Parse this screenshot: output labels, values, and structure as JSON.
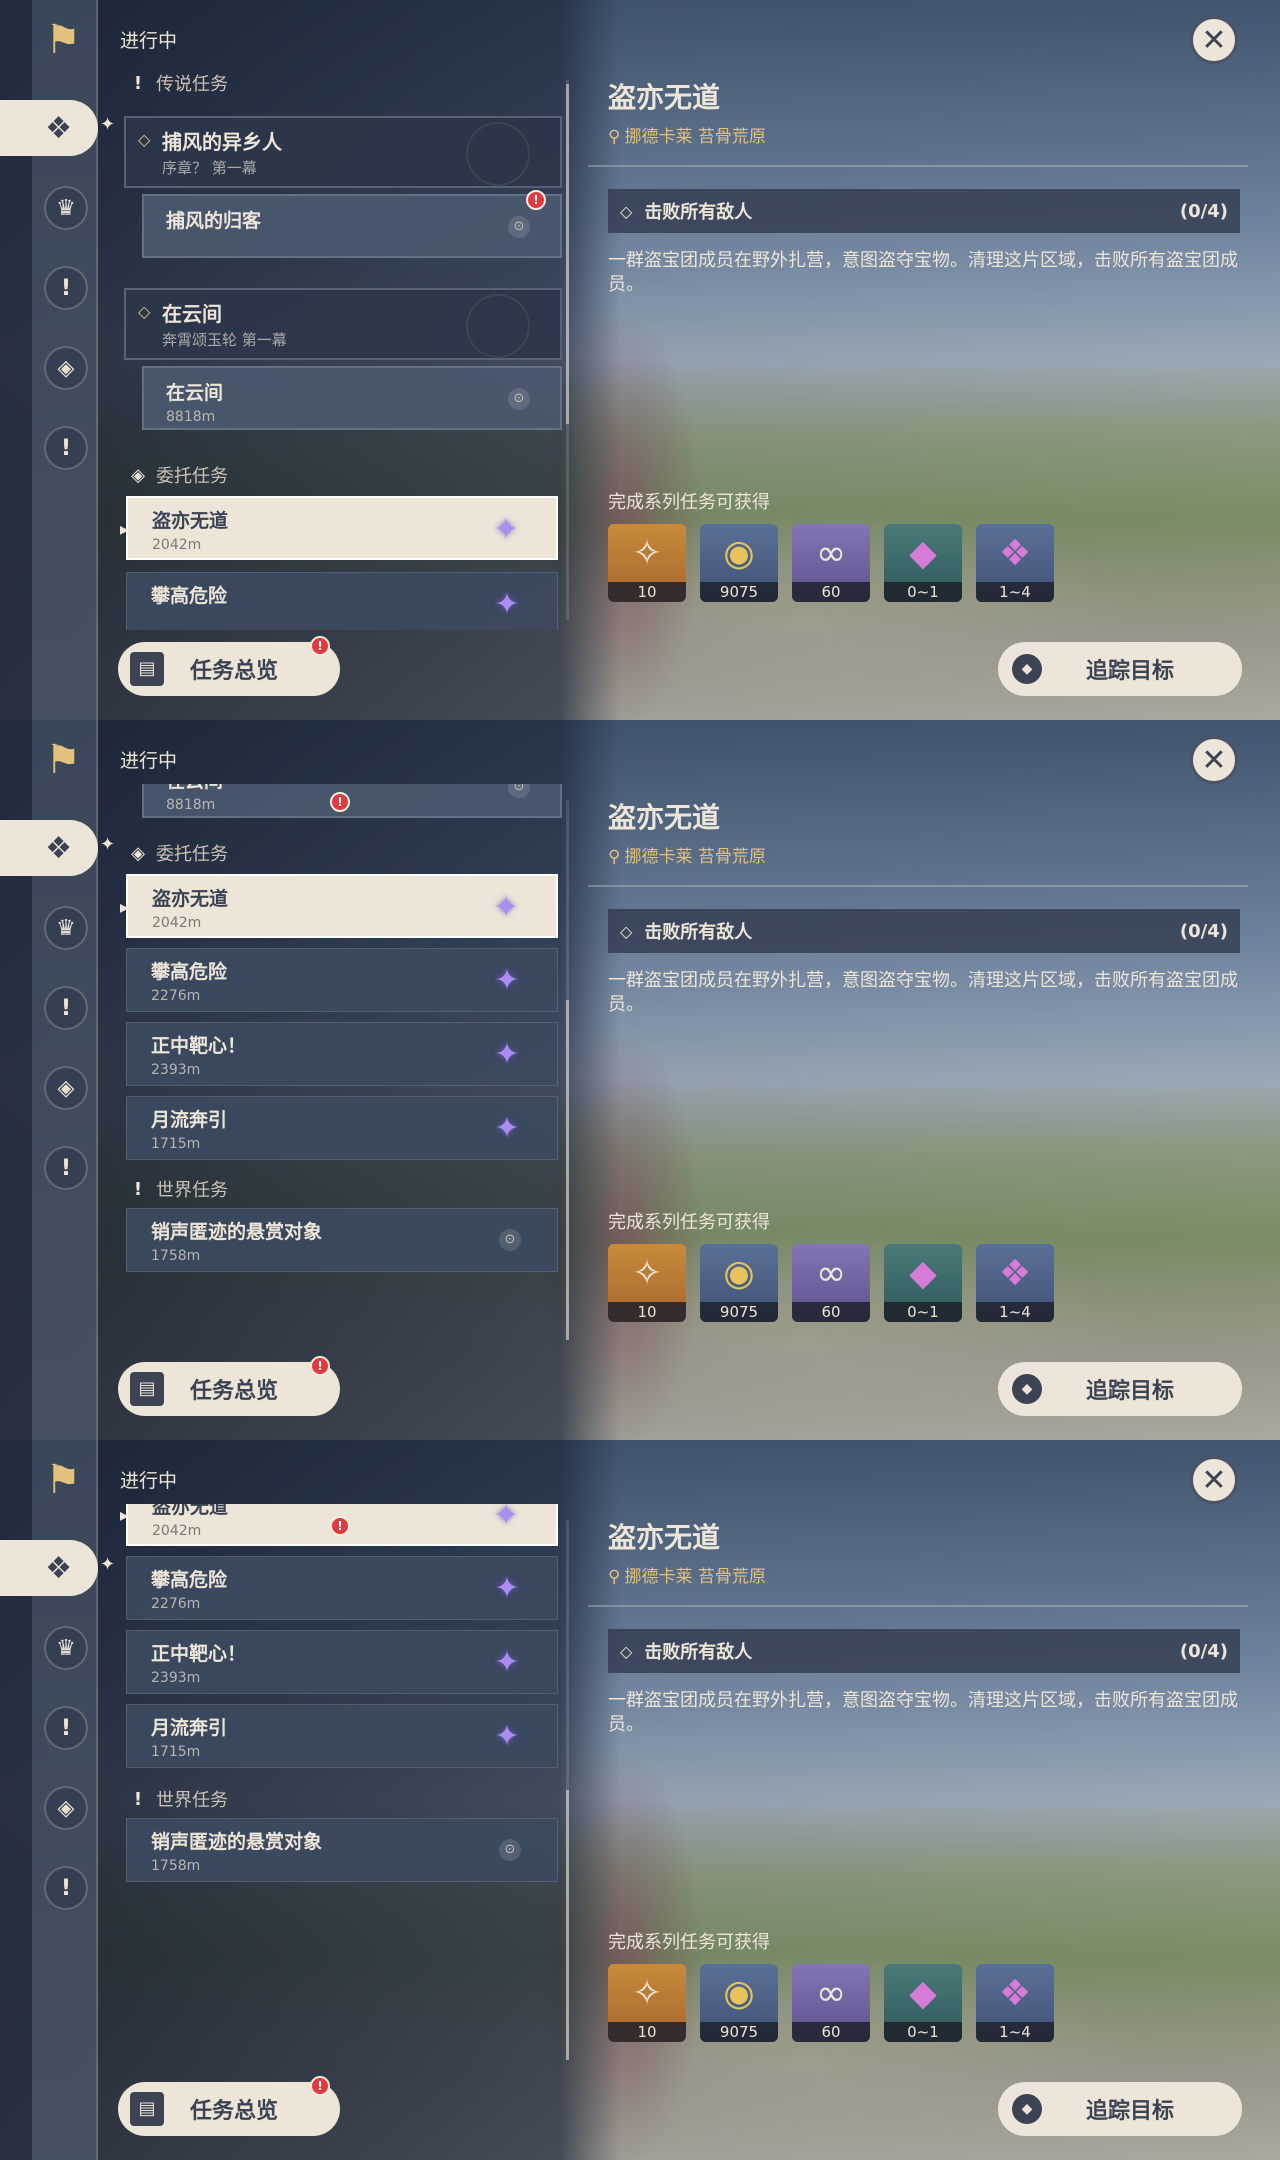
{
  "status": "进行中",
  "close_icon": "✕",
  "sections": {
    "legend": "传说任务",
    "commission": "委托任务",
    "world": "世界任务"
  },
  "legend_groups": [
    {
      "title": "捕风的异乡人",
      "sub": "序章？ 第一幕",
      "child": "捕风的归客",
      "child_dist": ""
    },
    {
      "title": "在云间",
      "sub": "奔霄颂玉轮 第一幕",
      "child": "在云间",
      "child_dist": "8818m"
    }
  ],
  "commissions": [
    {
      "title": "盗亦无道",
      "dist": "2042m"
    },
    {
      "title": "攀高危险",
      "dist": "2276m"
    },
    {
      "title": "正中靶心！",
      "dist": "2393m"
    },
    {
      "title": "月流奔引",
      "dist": "1715m"
    }
  ],
  "world_quests": [
    {
      "title": "销声匿迹的悬赏对象",
      "dist": "1758m"
    }
  ],
  "partial_text": {
    "frame2_top": "在云间",
    "frame3_top": "盗亦无道"
  },
  "detail": {
    "title": "盗亦无道",
    "location": "挪德卡莱 苔骨荒原",
    "objective": "击败所有敌人",
    "progress": "(0/4)",
    "description": "一群盗宝团成员在野外扎营，意图盗夺宝物。清理这片区域，击败所有盗宝团成员。",
    "rewards_label": "完成系列任务可获得",
    "rewards": [
      {
        "icon": "primogem-icon",
        "count": "10"
      },
      {
        "icon": "mora-icon",
        "count": "9075"
      },
      {
        "icon": "friendship-icon",
        "count": "60"
      },
      {
        "icon": "crystal-icon",
        "count": "0~1"
      },
      {
        "icon": "crystal-cluster-icon",
        "count": "1~4"
      }
    ]
  },
  "buttons": {
    "overview": "任务总览",
    "track": "追踪目标"
  },
  "colors": {
    "accent": "#ece5d8",
    "gold": "#e2c27c",
    "alert": "#e0393e",
    "commission_star": "#a98ef0"
  }
}
